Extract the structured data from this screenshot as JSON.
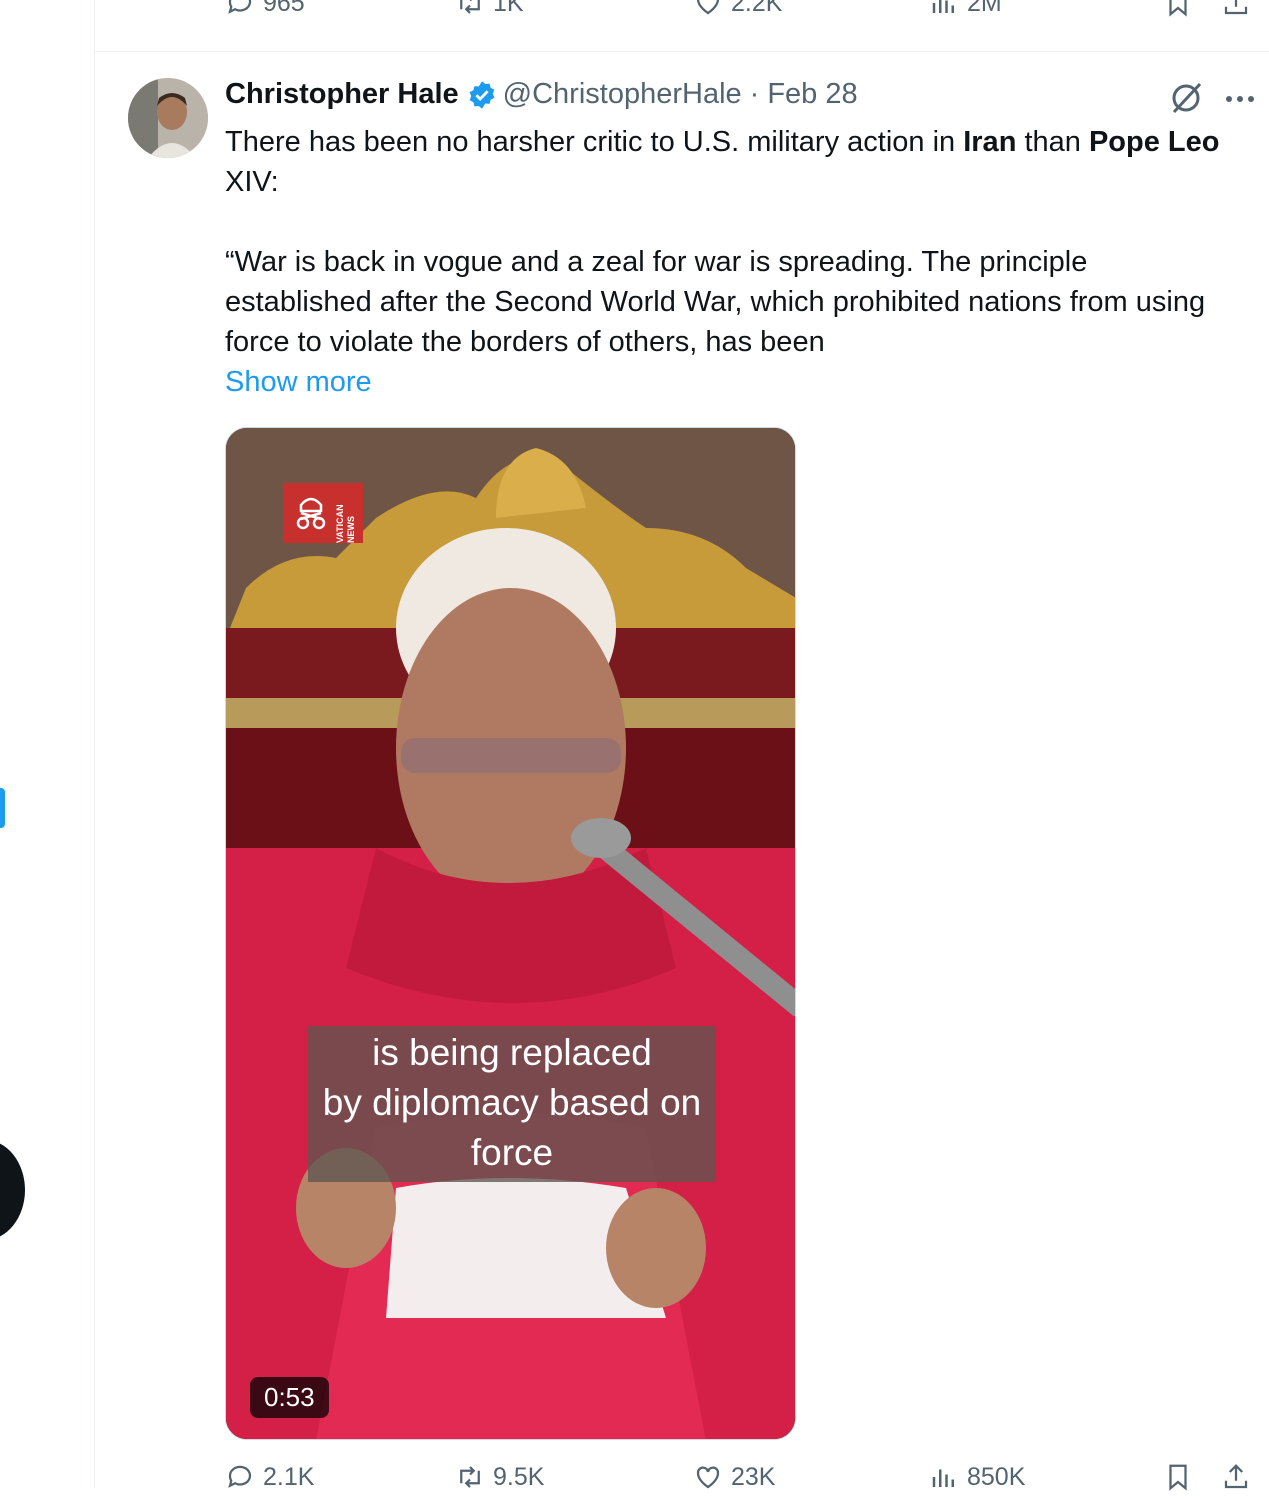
{
  "previous_tweet": {
    "actions": {
      "replies": "965",
      "reposts": "1K",
      "likes": "2.2K",
      "views": "2M"
    }
  },
  "tweet": {
    "author_name": "Christopher Hale",
    "handle": "@ChristopherHale",
    "separator": "·",
    "date": "Feb 28",
    "text": {
      "part1": "There has been no harsher critic to U.S. military action in ",
      "bold1": "Iran",
      "part2": " than ",
      "bold2": "Pope Leo",
      "part3": " XIV:",
      "quote": "“War is back in vogue and a zeal for war is spreading.  The principle established after the Second World War, which prohibited nations from using force to violate the borders of others, has been",
      "show_more": "Show more"
    },
    "media": {
      "logo_text": "VATICAN NEWS",
      "subtitle": "is being replaced\nby diplomacy based on\nforce",
      "duration": "0:53"
    },
    "actions": {
      "replies": "2.1K",
      "reposts": "9.5K",
      "likes": "23K",
      "views": "850K"
    }
  },
  "colors": {
    "accent": "#1d9bf0",
    "text": "#0f1419",
    "muted": "#536471"
  }
}
